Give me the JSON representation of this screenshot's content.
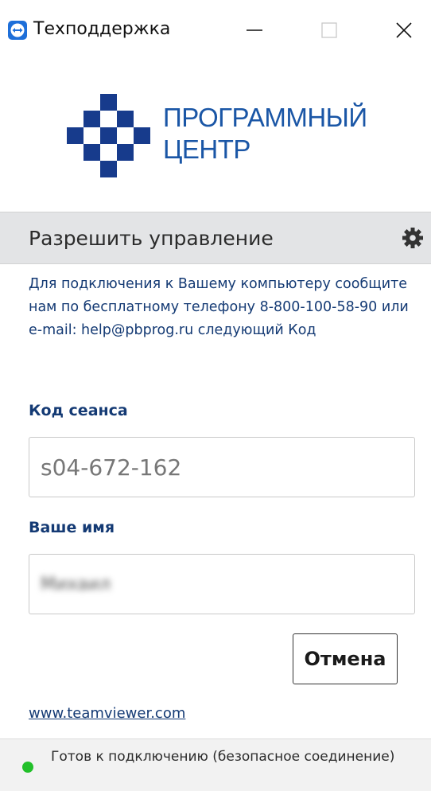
{
  "window": {
    "title": "Техподдержка",
    "icon": "teamviewer-icon",
    "controls": [
      "minimize-icon",
      "maximize-icon",
      "close-icon"
    ]
  },
  "logo": {
    "line1": "ПРОГРАММНЫЙ",
    "line2": "ЦЕНТР",
    "brand_color": "#1a56a6"
  },
  "section": {
    "title": "Разрешить управление",
    "settings_icon": "gear-icon"
  },
  "info_text": "Для подключения к Вашему компьютеру сообщите нам по бесплатному телефону 8-800-100-58-90 или e-mail: help@pbprog.ru следующий Код",
  "session": {
    "label": "Код сеанса",
    "value": "s04-672-162"
  },
  "name": {
    "label": "Ваше имя",
    "value": "Михаил"
  },
  "buttons": {
    "cancel": "Отмена"
  },
  "link": "www.teamviewer.com",
  "status": {
    "text": "Готов к подключению (безопасное соединение)",
    "color": "#22c02a"
  },
  "colors": {
    "accent": "#143a74",
    "header_bg": "#e3e4e6"
  }
}
